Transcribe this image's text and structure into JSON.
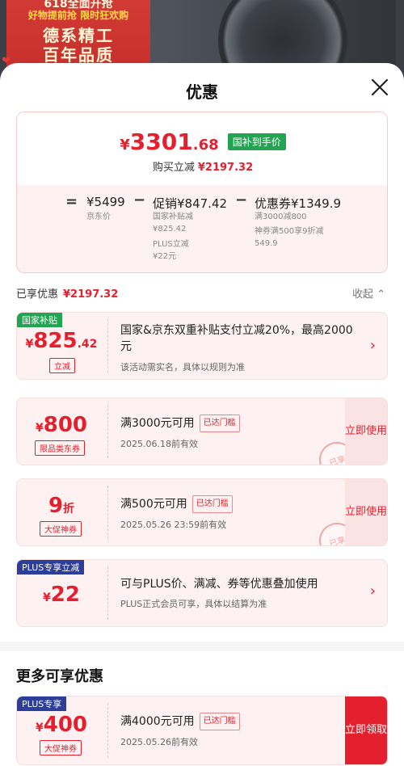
{
  "banner": {
    "line1": "618全面开抢",
    "line2": "好物提前抢 限时狂欢购",
    "line3": "德系精工",
    "line4": "百年品质"
  },
  "sheet": {
    "title": "优惠"
  },
  "summary": {
    "price_symbol": "¥",
    "price_int": "3301",
    "price_dec": ".68",
    "price_tag": "国补到手价",
    "buy_label": "购买立减",
    "buy_amount": "¥2197.32",
    "equals": "=",
    "base_price": "¥5499",
    "base_label": "京东价",
    "minus1": "−",
    "promo_label_price": "促销¥847.42",
    "promo_sub1": "国家补贴减",
    "promo_sub1_val": "¥825.42",
    "promo_sub2": "PLUS立减",
    "promo_sub2_val": "¥22元",
    "minus2": "−",
    "coupon_label_price": "优惠券¥1349.9",
    "coupon_sub1": "满3000减800",
    "coupon_sub2": "神券满500享9折减",
    "coupon_sub2_val": "549.9"
  },
  "enjoyed": {
    "label": "已享优惠",
    "amount": "¥2197.32",
    "collapse": "收起"
  },
  "cards": [
    {
      "badge": "国家补贴",
      "sym": "¥",
      "big": "825",
      "small": ".42",
      "tag": "立减",
      "desc": "国家&京东双重补贴支付立减20%，最高2000元",
      "note": "该活动需实名，具体以规则为准",
      "arrow": "›"
    },
    {
      "sym": "¥",
      "big": "800",
      "tag": "限品类东券",
      "desc": "满3000元可用",
      "threshold": "已达门槛",
      "note": "2025.06.18前有效",
      "button": "立即使用",
      "stamp": "已享"
    },
    {
      "big": "9",
      "small": "折",
      "tag": "大促神券",
      "desc": "满500元可用",
      "threshold": "已达门槛",
      "note": "2025.05.26  23:59前有效",
      "button": "立即使用",
      "stamp": "已享"
    },
    {
      "badge": "PLUS专享立减",
      "sym": "¥",
      "big": "22",
      "desc": "可与PLUS价、满减、券等优惠叠加使用",
      "note": "PLUS正式会员可享，具体以结算为准",
      "arrow": "›"
    }
  ],
  "more": {
    "title": "更多可享优惠",
    "card": {
      "badge": "PLUS专享",
      "sym": "¥",
      "big": "400",
      "tag": "大促神券",
      "desc": "满4000元可用",
      "threshold": "已达门槛",
      "note": "2025.05.26前有效",
      "button": "立即领取"
    }
  },
  "colors": {
    "accent": "#e4202e",
    "green": "#23a453",
    "blue": "#2d3e9a",
    "card_bg": "#fdf1f1"
  },
  "icons": {
    "close": "close-icon",
    "chevron": "chevron-up-icon",
    "arrow": "chevron-right-icon"
  }
}
